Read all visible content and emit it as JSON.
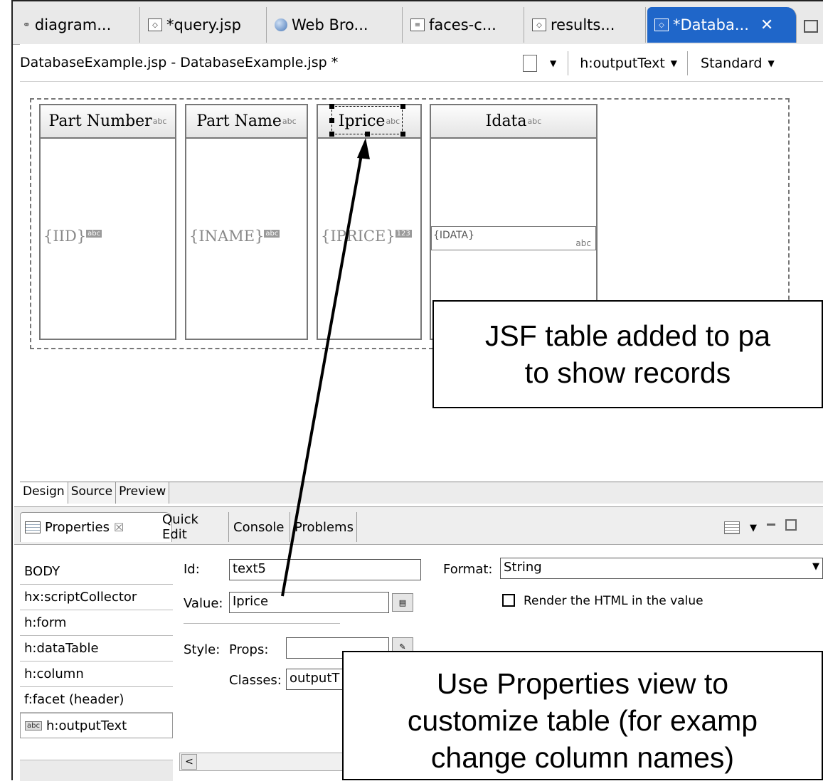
{
  "editor_tabs": [
    {
      "label": "diagram..."
    },
    {
      "label": "*query.jsp"
    },
    {
      "label": "Web Bro..."
    },
    {
      "label": "faces-c..."
    },
    {
      "label": "results..."
    },
    {
      "label": "*Databa..."
    }
  ],
  "breadcrumb": "DatabaseExample.jsp - DatabaseExample.jsp *",
  "toolbar": {
    "element": "h:outputText",
    "mode": "Standard"
  },
  "table": {
    "columns": [
      {
        "header": "Part Number",
        "header_tag": "abc",
        "cell": "{IID}",
        "cell_tag": "abc"
      },
      {
        "header": "Part Name",
        "header_tag": "abc",
        "cell": "{INAME}",
        "cell_tag": "abc"
      },
      {
        "header": "Iprice",
        "header_tag": "abc",
        "cell": "{IPRICE}",
        "cell_tag": "123"
      },
      {
        "header": "Idata",
        "header_tag": "abc",
        "cell": "{IDATA}",
        "cell_tag": "abc"
      }
    ]
  },
  "callouts": {
    "top_line1": "JSF table added to pa",
    "top_line2": "to show records",
    "bottom_line1": "Use Properties view to",
    "bottom_line2": "customize table (for examp",
    "bottom_line3": "change column names)"
  },
  "page_tabs": [
    "Design",
    "Source",
    "Preview"
  ],
  "view_tabs": [
    "Properties",
    "Quick Edit",
    "Console",
    "Problems"
  ],
  "properties": {
    "tree": [
      "BODY",
      "hx:scriptCollector",
      "h:form",
      "h:dataTable",
      "h:column",
      "f:facet (header)",
      "h:outputText"
    ],
    "tree_selected_tag": "abc",
    "id_label": "Id:",
    "id_value": "text5",
    "value_label": "Value:",
    "value_value": "Iprice",
    "style_label": "Style:",
    "props_label": "Props:",
    "props_value": "",
    "classes_label": "Classes:",
    "classes_value": "outputT",
    "format_label": "Format:",
    "format_value": "String",
    "render_label": "Render the HTML in the value"
  }
}
